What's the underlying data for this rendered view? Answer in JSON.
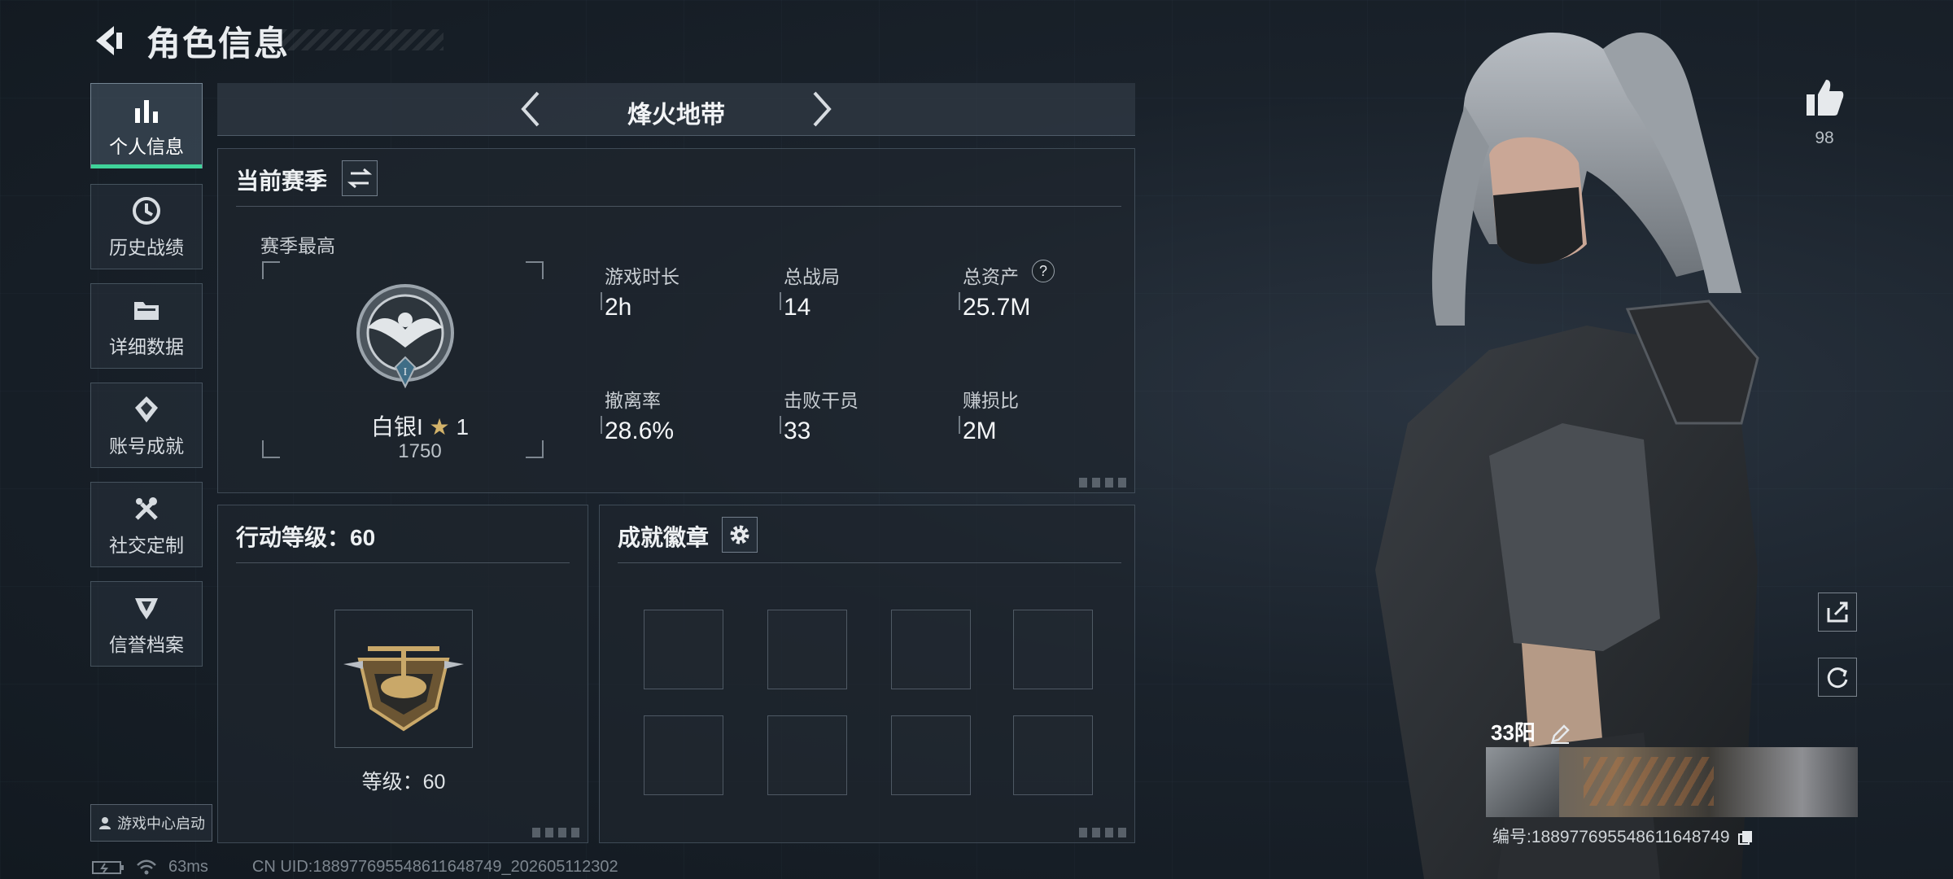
{
  "header": {
    "title": "角色信息"
  },
  "sidebar": {
    "items": [
      {
        "label": "个人信息",
        "icon": "bar-chart-icon",
        "active": true
      },
      {
        "label": "历史战绩",
        "icon": "history-icon"
      },
      {
        "label": "详细数据",
        "icon": "folder-icon"
      },
      {
        "label": "账号成就",
        "icon": "achievement-icon"
      },
      {
        "label": "社交定制",
        "icon": "tools-icon"
      },
      {
        "label": "信誉档案",
        "icon": "shield-icon"
      }
    ],
    "launch_label": "游戏中心启动"
  },
  "mode": {
    "title": "烽火地带"
  },
  "season": {
    "title": "当前赛季",
    "best_label": "赛季最高",
    "rank_name": "白银I",
    "rank_stars": "1",
    "rank_points": "1750",
    "rank_roman": "I",
    "stats": [
      {
        "label": "游戏时长",
        "value": "2h"
      },
      {
        "label": "总战局",
        "value": "14"
      },
      {
        "label": "总资产",
        "value": "25.7M",
        "help": "?"
      },
      {
        "label": "撤离率",
        "value": "28.6%"
      },
      {
        "label": "击败干员",
        "value": "33"
      },
      {
        "label": "赚损比",
        "value": "2M"
      }
    ]
  },
  "level": {
    "title": "行动等级：60",
    "caption": "等级：60"
  },
  "badges": {
    "title": "成就徽章"
  },
  "profile": {
    "likes": "98",
    "name": "33阳",
    "id_text": "编号:1889776955486116487​49"
  },
  "status": {
    "ping": "63ms",
    "uid": "CN UID:188977695548611648749_202605112302"
  },
  "colors": {
    "accent": "#3fd39a",
    "panel": "#1e262e"
  }
}
